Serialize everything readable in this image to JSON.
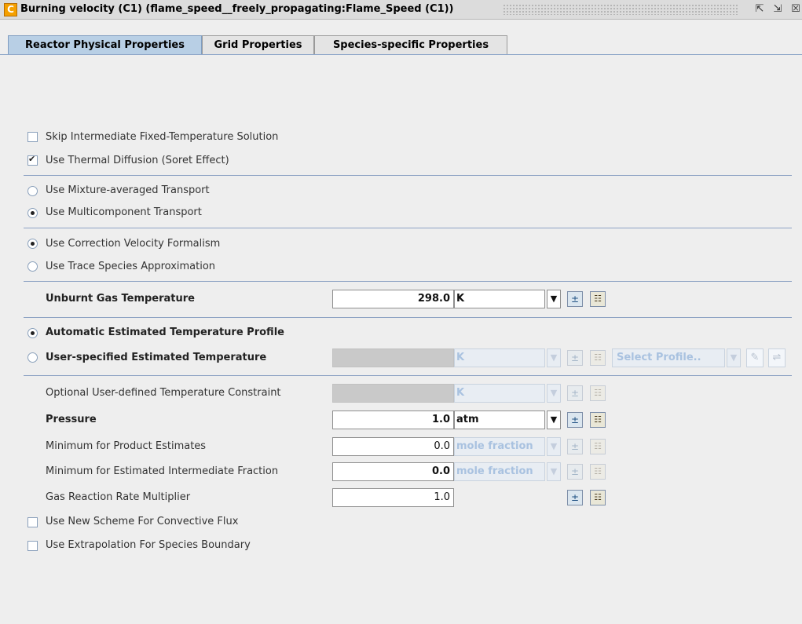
{
  "window": {
    "logo_text": "C",
    "title": "Burning velocity (C1)  (flame_speed__freely_propagating:Flame_Speed (C1))",
    "minimize_icon": "restore-icon",
    "maximize_icon": "maximize-icon",
    "close_icon": "close-icon"
  },
  "tabs": [
    {
      "label": "Reactor Physical Properties",
      "active": true
    },
    {
      "label": "Grid Properties",
      "active": false
    },
    {
      "label": "Species-specific Properties",
      "active": false
    }
  ],
  "options": {
    "skip_intermediate": "Skip Intermediate Fixed-Temperature Solution",
    "thermal_diffusion": "Use Thermal Diffusion (Soret Effect)",
    "mixture_averaged": "Use Mixture-averaged Transport",
    "multicomponent": "Use Multicomponent Transport",
    "correction_velocity": "Use Correction Velocity Formalism",
    "trace_species": "Use Trace Species Approximation",
    "automatic_profile": "Automatic Estimated Temperature Profile",
    "user_specified": "User-specified Estimated Temperature",
    "new_scheme": "Use New Scheme For Convective Flux",
    "extrapolation": "Use Extrapolation For Species Boundary"
  },
  "fields": {
    "unburnt_temperature": {
      "label": "Unburnt Gas Temperature",
      "value": "298.0",
      "unit": "K"
    },
    "user_temperature": {
      "unit": "K",
      "profile": "Select Profile.."
    },
    "optional_constraint": {
      "label": "Optional User-defined Temperature Constraint",
      "unit": "K"
    },
    "pressure": {
      "label": "Pressure",
      "value": "1.0",
      "unit": "atm"
    },
    "product_estimates": {
      "label": "Minimum for Product Estimates",
      "value": "0.0",
      "unit": "mole fraction"
    },
    "intermediate_fraction": {
      "label": "Minimum for Estimated Intermediate Fraction",
      "value": "0.0",
      "unit": "mole fraction"
    },
    "rate_multiplier": {
      "label": "Gas Reaction Rate Multiplier",
      "value": "1.0"
    }
  }
}
